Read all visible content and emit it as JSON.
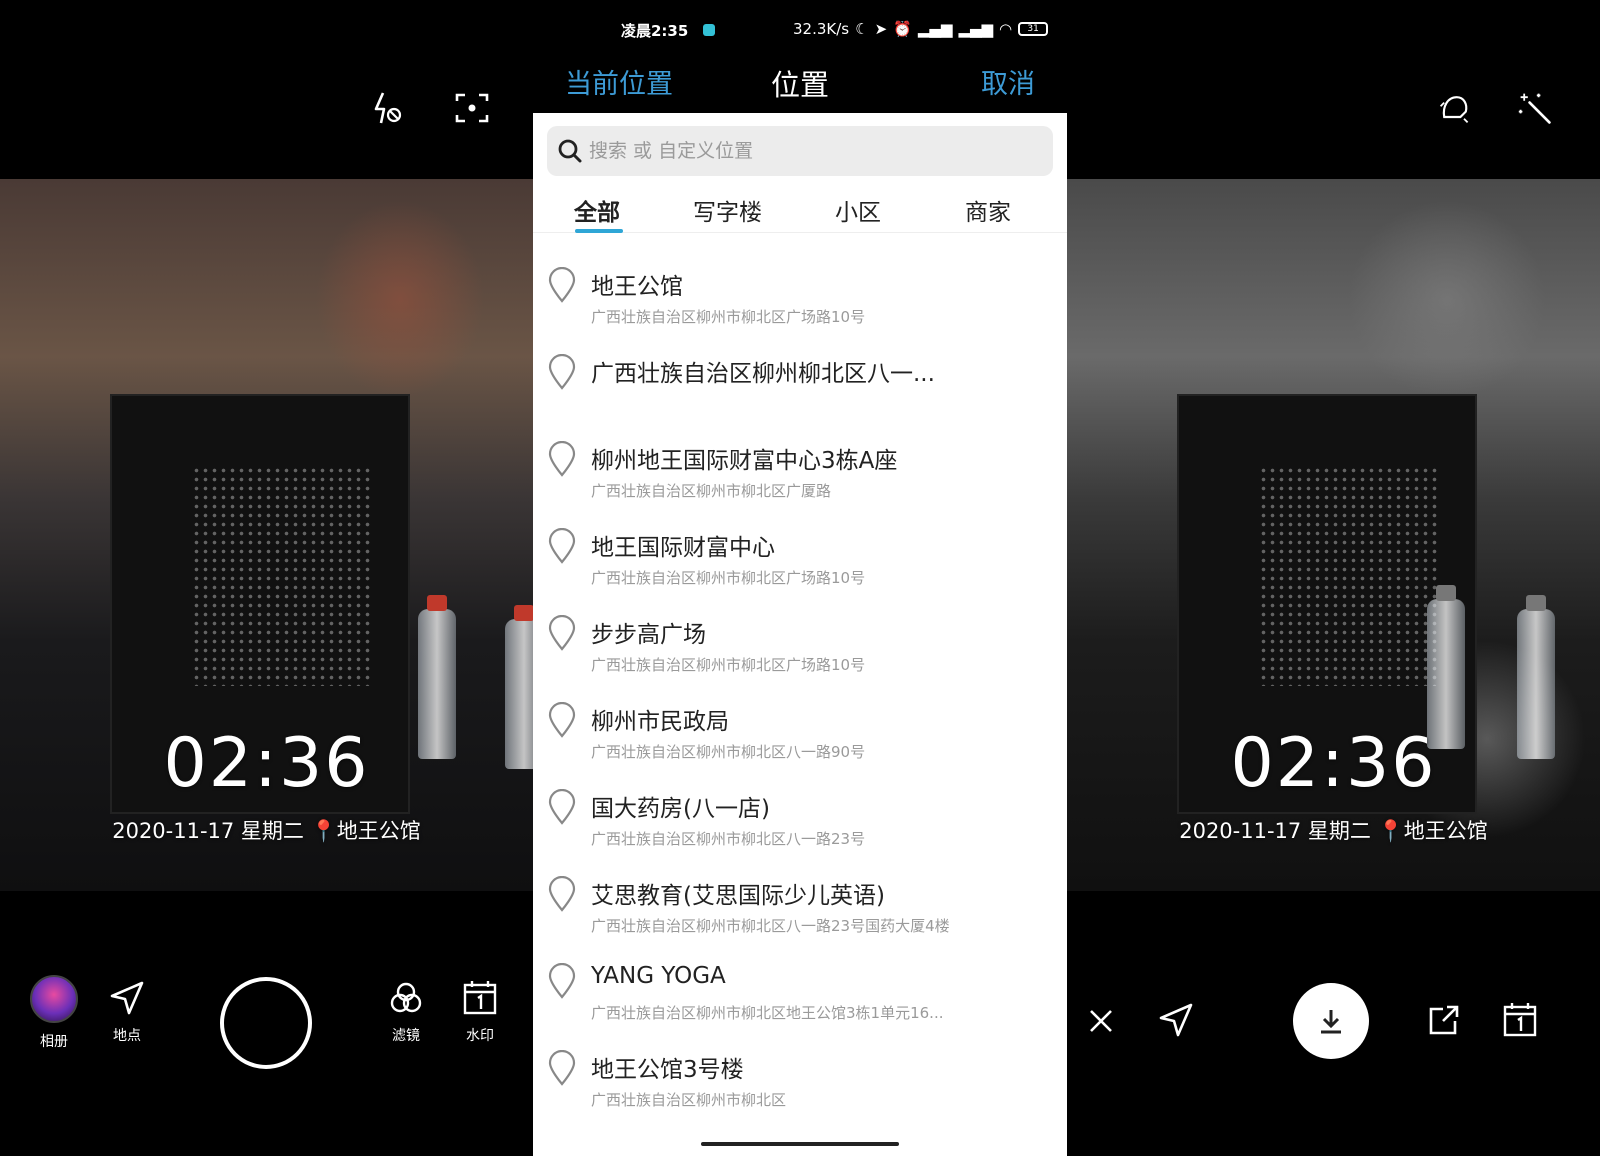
{
  "left": {
    "watermark": {
      "time": "02:36",
      "date": "2020-11-17 星期二",
      "place": "地王公馆"
    },
    "bottom": {
      "album": "相册",
      "location": "地点",
      "filter": "滤镜",
      "watermark": "水印"
    }
  },
  "center": {
    "status": {
      "time": "凌晨2:35",
      "net": "32.3K/s",
      "battery": "31"
    },
    "header": {
      "current": "当前位置",
      "title": "位置",
      "cancel": "取消"
    },
    "search": {
      "placeholder": "搜索 或 自定义位置"
    },
    "tabs": [
      "全部",
      "写字楼",
      "小区",
      "商家"
    ],
    "items": [
      {
        "name": "地王公馆",
        "addr": "广西壮族自治区柳州市柳北区广场路10号"
      },
      {
        "name": "广西壮族自治区柳州柳北区八一...",
        "addr": ""
      },
      {
        "name": "柳州地王国际财富中心3栋A座",
        "addr": "广西壮族自治区柳州市柳北区广厦路"
      },
      {
        "name": "地王国际财富中心",
        "addr": "广西壮族自治区柳州市柳北区广场路10号"
      },
      {
        "name": "步步高广场",
        "addr": "广西壮族自治区柳州市柳北区广场路10号"
      },
      {
        "name": "柳州市民政局",
        "addr": "广西壮族自治区柳州市柳北区八一路90号"
      },
      {
        "name": "国大药房(八一店)",
        "addr": "广西壮族自治区柳州市柳北区八一路23号"
      },
      {
        "name": "艾思教育(艾思国际少儿英语)",
        "addr": "广西壮族自治区柳州市柳北区八一路23号国药大厦4楼"
      },
      {
        "name": "YANG YOGA",
        "addr": "广西壮族自治区柳州市柳北区地王公馆3栋1单元16..."
      },
      {
        "name": "地王公馆3号楼",
        "addr": "广西壮族自治区柳州市柳北区"
      }
    ]
  },
  "right": {
    "watermark": {
      "time": "02:36",
      "date": "2020-11-17 星期二",
      "place": "地王公馆"
    }
  },
  "colors": {
    "accent": "#3d9bd6",
    "pin": "#e53935"
  }
}
